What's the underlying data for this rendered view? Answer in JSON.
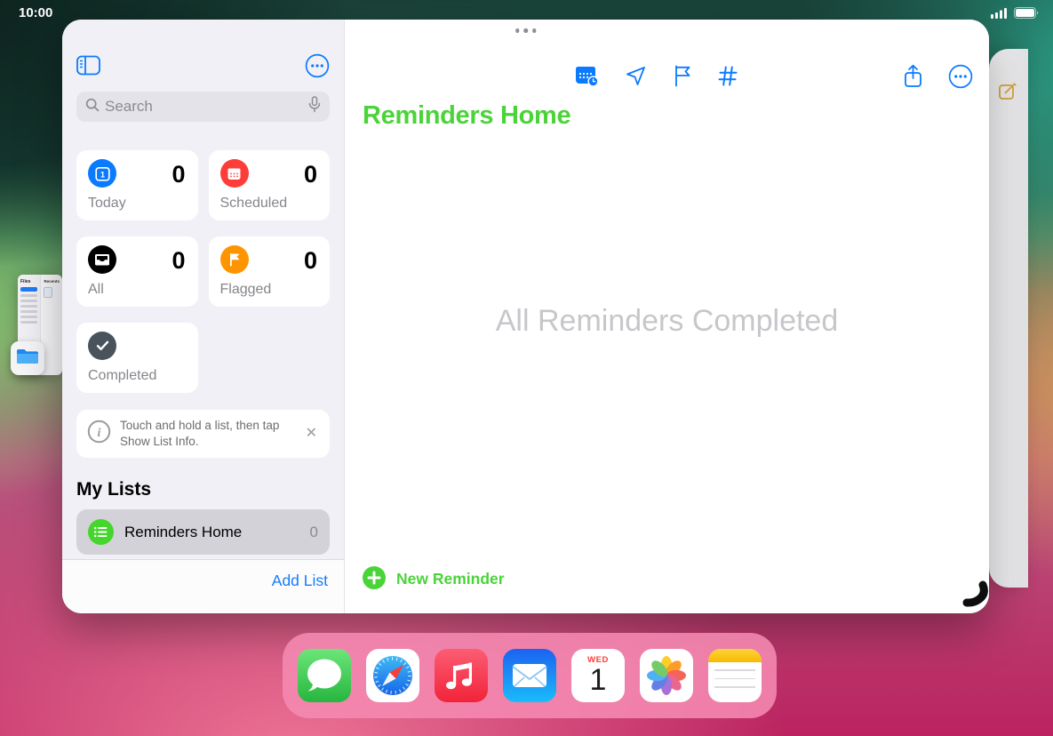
{
  "status_bar": {
    "time": "10:00",
    "signal_icon": "signal-bars-full",
    "battery_icon": "battery-full"
  },
  "reminders_window": {
    "sidebar": {
      "toggle_icon": "sidebar-toggle",
      "more_icon": "ellipsis-circle",
      "search": {
        "placeholder": "Search",
        "mic_icon": "microphone"
      },
      "smart_lists": [
        {
          "label": "Today",
          "count": "0",
          "color": "#0a7aff",
          "icon": "calendar-today",
          "icon_day": "1"
        },
        {
          "label": "Scheduled",
          "count": "0",
          "color": "#fc3d39",
          "icon": "calendar-grid"
        },
        {
          "label": "All",
          "count": "0",
          "color": "#000000",
          "icon": "tray"
        },
        {
          "label": "Flagged",
          "count": "0",
          "color": "#fe9500",
          "icon": "flag"
        },
        {
          "label": "Completed",
          "count": "",
          "color": "#48535c",
          "icon": "checkmark"
        }
      ],
      "tip": {
        "info_glyph": "i",
        "text": "Touch and hold a list, then tap Show List Info.",
        "close_glyph": "✕"
      },
      "my_lists_header": "My Lists",
      "lists": [
        {
          "name": "Reminders Home",
          "count": "0",
          "color": "#44d62c",
          "icon": "list-bullet"
        }
      ],
      "add_list_label": "Add List"
    },
    "main": {
      "toolbar_icons": [
        "calendar-badge",
        "send-location",
        "flag-outline",
        "hashtag",
        "share",
        "ellipsis-circle"
      ],
      "title": "Reminders Home",
      "title_color": "#4bd33a",
      "empty_state": "All Reminders Completed",
      "new_reminder_label": "New Reminder",
      "accent_green": "#4bd33a",
      "accent_blue": "#0a7aff"
    }
  },
  "files_preview": {
    "app_title": "Files",
    "section_label": "Recents",
    "app_icon": "files-folder"
  },
  "right_sliver": {
    "compose_icon": "compose-square-pencil",
    "color": "#d9a43c"
  },
  "dock": {
    "apps": [
      "messages",
      "safari",
      "music",
      "mail",
      "calendar",
      "photos",
      "notes"
    ],
    "calendar": {
      "weekday": "WED",
      "day": "1"
    }
  }
}
